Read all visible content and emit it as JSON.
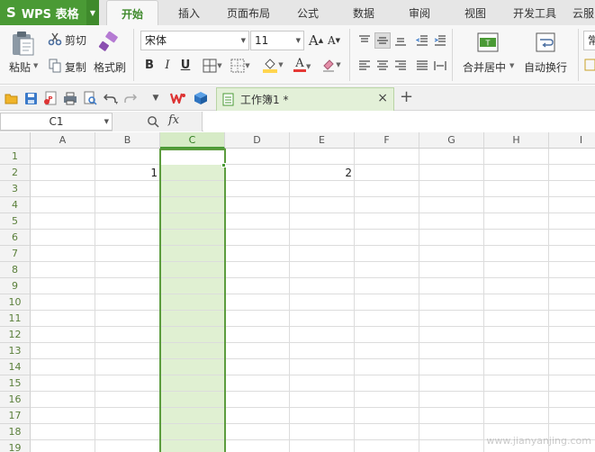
{
  "app": {
    "title": "WPS 表格",
    "logo": "S"
  },
  "ribbon_tabs": [
    "开始",
    "插入",
    "页面布局",
    "公式",
    "数据",
    "审阅",
    "视图",
    "开发工具",
    "云服"
  ],
  "active_tab": "开始",
  "clipboard": {
    "paste_label": "粘贴",
    "cut_label": "剪切",
    "copy_label": "复制",
    "format_painter_label": "格式刷"
  },
  "font": {
    "family": "宋体",
    "size": "11",
    "increase_glyph": "A",
    "decrease_glyph": "A",
    "bold_glyph": "B",
    "italic_glyph": "I",
    "underline_glyph": "U",
    "font_color_glyph": "A",
    "font_color": "#e53935",
    "fill_color": "#ffd54f"
  },
  "alignment": {
    "merge_center_label": "合并居中",
    "wrap_text_label": "自动换行"
  },
  "number_format": {
    "value": "常"
  },
  "quick_access": {
    "icons": [
      "open-icon",
      "save-icon",
      "export-pdf-icon",
      "print-icon",
      "print-preview-icon",
      "undo-icon",
      "redo-icon",
      "customize-icon",
      "wps-logo-icon",
      "cube-icon"
    ]
  },
  "document_tab": {
    "title": "工作簿1 *",
    "close_glyph": "×",
    "new_tab_glyph": "+"
  },
  "formula_bar": {
    "cell_ref": "C1",
    "fx_glyph": "fx",
    "formula": ""
  },
  "grid": {
    "columns": [
      "A",
      "B",
      "C",
      "D",
      "E",
      "F",
      "G",
      "H",
      "I"
    ],
    "rows": [
      "1",
      "2",
      "3",
      "4",
      "5",
      "6",
      "7",
      "8",
      "9",
      "10",
      "11",
      "12",
      "13",
      "14",
      "15",
      "16",
      "17",
      "18",
      "19"
    ],
    "selected_column": "C",
    "active_cell": "C1",
    "cells": [
      {
        "ref": "B2",
        "value": "1"
      },
      {
        "ref": "E2",
        "value": "2"
      }
    ]
  },
  "colors": {
    "accent": "#4a9a35",
    "selection_fill": "#e0f0d2",
    "selection_border": "#5c9c3e"
  },
  "watermark": "www.jianyanjing.com"
}
